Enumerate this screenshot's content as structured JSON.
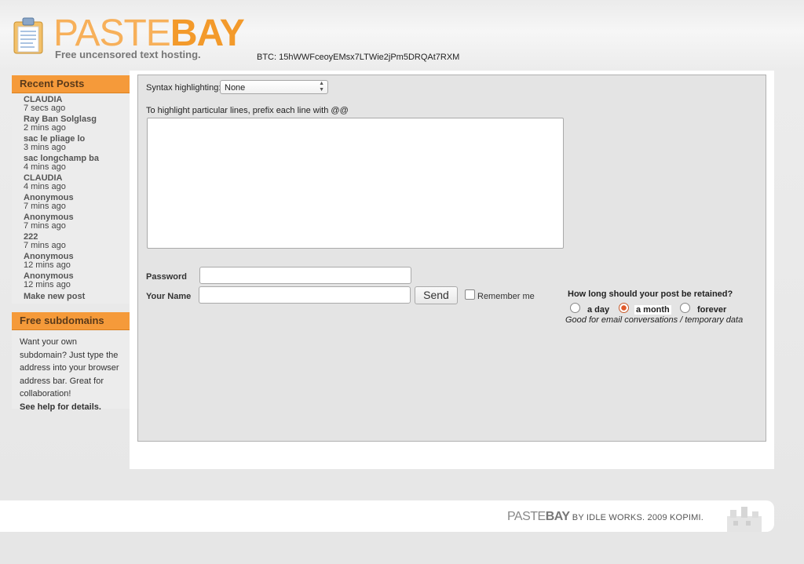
{
  "header": {
    "logo_paste": "PASTE",
    "logo_bay": "BAY",
    "tagline": "Free uncensored text hosting.",
    "btc": "BTC: 15hWWFceoyEMsx7LTWie2jPm5DRQAt7RXM"
  },
  "sidebar": {
    "recent_title": "Recent Posts",
    "posts": [
      {
        "title": "CLAUDIA",
        "time": "7 secs ago"
      },
      {
        "title": "Ray Ban Solglasg",
        "time": "2 mins ago"
      },
      {
        "title": "sac le pliage lo",
        "time": "3 mins ago"
      },
      {
        "title": "sac longchamp ba",
        "time": "4 mins ago"
      },
      {
        "title": "CLAUDIA",
        "time": "4 mins ago"
      },
      {
        "title": "Anonymous",
        "time": "7 mins ago"
      },
      {
        "title": "Anonymous",
        "time": "7 mins ago"
      },
      {
        "title": "222",
        "time": "7 mins ago"
      },
      {
        "title": "Anonymous",
        "time": "12 mins ago"
      },
      {
        "title": "Anonymous",
        "time": "12 mins ago"
      }
    ],
    "make_new": "Make new post",
    "subdomains_title": "Free subdomains",
    "subdomains_text": "Want your own subdomain? Just type the address into your browser address bar. Great for collaboration!",
    "subdomains_help": "See help for details."
  },
  "form": {
    "syntax_label": "Syntax highlighting:",
    "syntax_value": "None",
    "highlight_hint": "To highlight particular lines, prefix each line with @@",
    "code_value": "",
    "password_label": "Password",
    "password_value": "",
    "name_label": "Your Name",
    "name_value": "",
    "send_label": "Send",
    "remember_label": "Remember me",
    "remember_checked": false,
    "retain_question": "How long should your post be retained?",
    "retain_options": [
      "a day",
      "a month",
      "forever"
    ],
    "retain_selected": "a month",
    "retain_note": "Good for email conversations / temporary data"
  },
  "footer": {
    "paste": "PASTE",
    "bay": "BAY",
    "credit": " BY IDLE WORKS. 2009 KOPIMI."
  },
  "colors": {
    "accent": "#f59a3a",
    "logo_light": "#f7b05a",
    "logo_dark": "#f39a2b",
    "content_bg": "#e4e4e4"
  }
}
